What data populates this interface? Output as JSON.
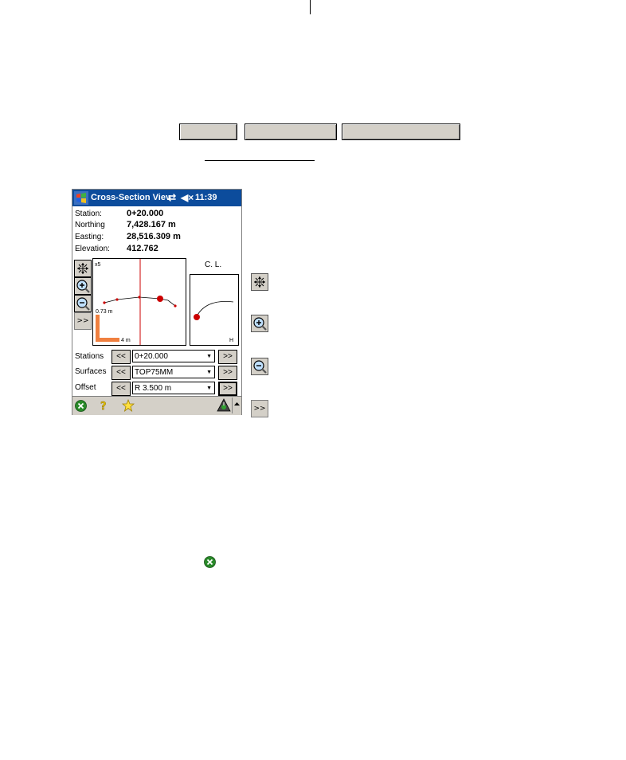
{
  "top_buttons": [
    "",
    "",
    ""
  ],
  "pda": {
    "title": "Cross-Section Viev",
    "clock": "11:39",
    "info": [
      {
        "label": "Station:",
        "value": "0+20.000"
      },
      {
        "label": "Northing",
        "value": "7,428.167 m"
      },
      {
        "label": "Easting:",
        "value": "28,516.309 m"
      },
      {
        "label": "Elevation:",
        "value": "412.762"
      }
    ],
    "plot": {
      "scale_label": "x5",
      "vertical_scale": "0.73 m",
      "horizontal_scale": "4 m"
    },
    "side_plot": {
      "cl_label": "C. L.",
      "h_label": "H"
    },
    "more_label": ">>",
    "rows": [
      {
        "label": "Stations",
        "prev": "<<",
        "value": "0+20.000",
        "next": ">>"
      },
      {
        "label": "Surfaces",
        "prev": "<<",
        "value": "TOP75MM",
        "next": ">>"
      },
      {
        "label": "Offset",
        "prev": "<<",
        "value": "R 3.500 m",
        "next": ">>"
      }
    ]
  },
  "legend": {
    "more_label": ">>"
  },
  "colors": {
    "titlebar": "#0c4c9c",
    "button_face": "#d4d0c8",
    "plot_red": "#cc0000",
    "scale_orange": "#f08040",
    "ok_green": "#2a8a2a"
  }
}
